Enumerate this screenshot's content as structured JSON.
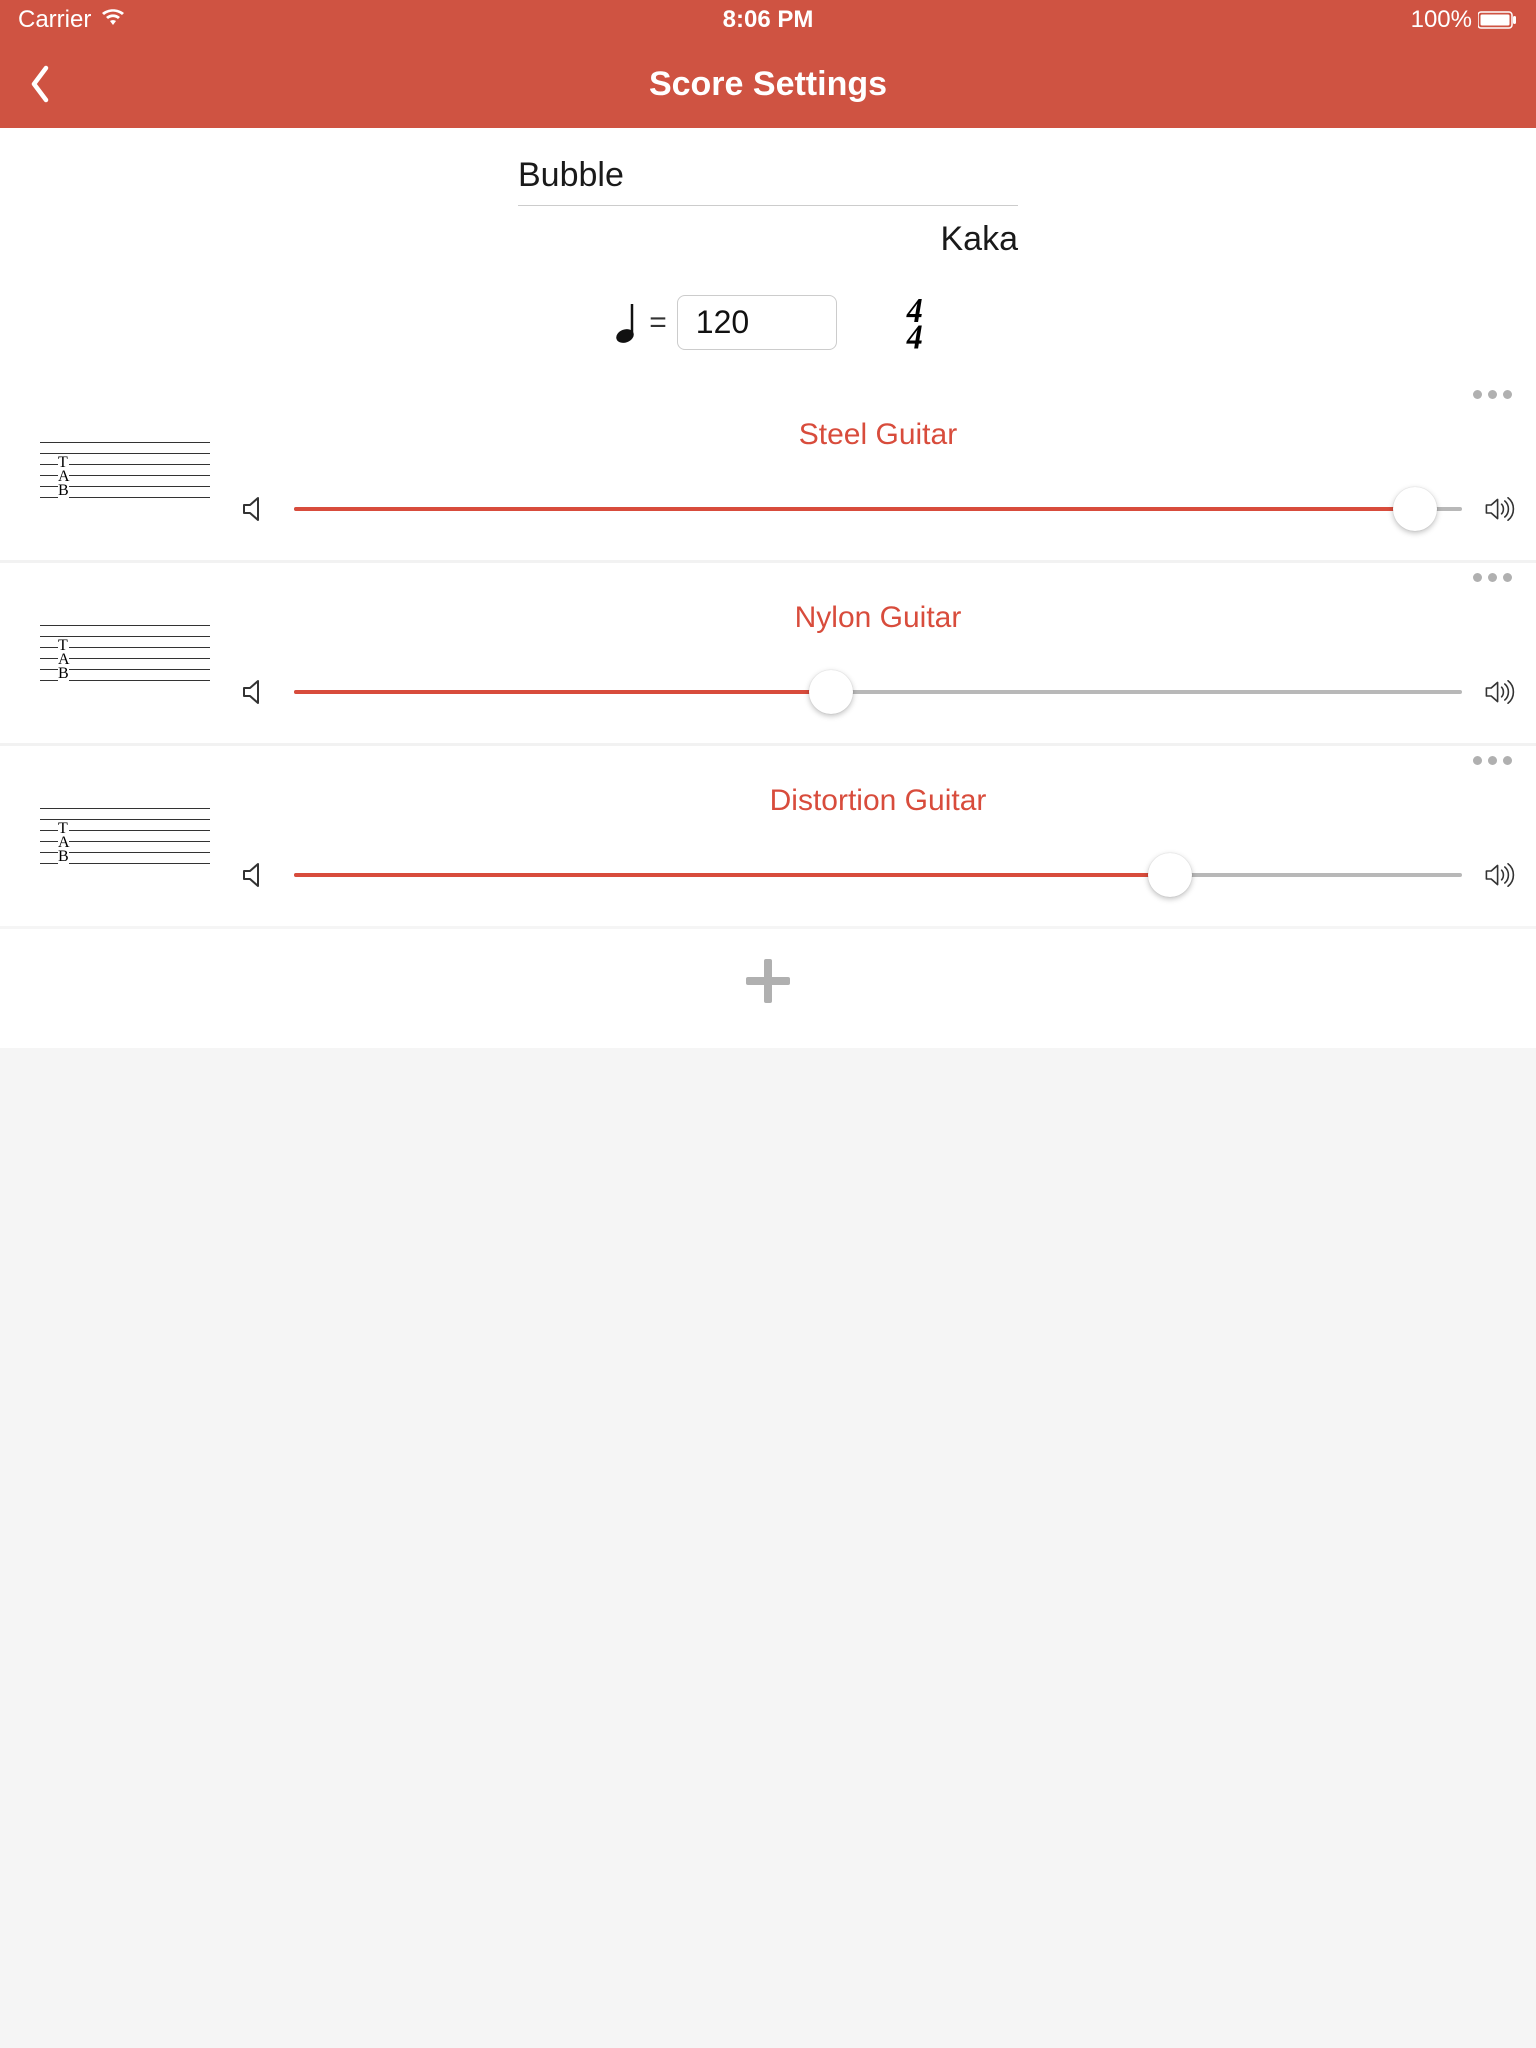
{
  "status": {
    "carrier": "Carrier",
    "time": "8:06 PM",
    "battery": "100%"
  },
  "nav": {
    "title": "Score Settings"
  },
  "score": {
    "title": "Bubble",
    "author": "Kaka",
    "tempo_value": "120",
    "time_sig_top": "4",
    "time_sig_bottom": "4"
  },
  "tracks": [
    {
      "name": "Steel Guitar",
      "volume_percent": 96
    },
    {
      "name": "Nylon Guitar",
      "volume_percent": 46
    },
    {
      "name": "Distortion Guitar",
      "volume_percent": 75
    }
  ],
  "staff_tab_label": "T\nA\nB"
}
